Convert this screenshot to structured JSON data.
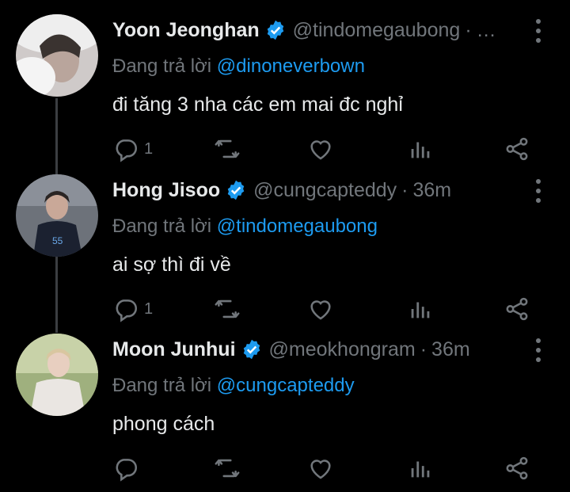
{
  "tweets": [
    {
      "name": "Yoon Jeonghan",
      "handle": "@tindomegaubong",
      "separator": "·",
      "time": "",
      "replying_prefix": "Đang trả lời ",
      "replying_to": "@dinoneverbown",
      "text": "đi tăng 3 nha các em mai đc nghỉ",
      "reply_count": "1",
      "retweet_count": "",
      "like_count": "",
      "avatar_color": "#d8d4d2"
    },
    {
      "name": "Hong Jisoo",
      "handle": "@cungcapteddy",
      "separator": "·",
      "time": "36m",
      "replying_prefix": "Đang trả lời ",
      "replying_to": "@tindomegaubong",
      "text": "ai sợ thì đi về",
      "reply_count": "1",
      "retweet_count": "",
      "like_count": "",
      "avatar_color": "#5a5f66"
    },
    {
      "name": "Moon Junhui",
      "handle": "@meokhongram",
      "separator": "·",
      "time": "36m",
      "replying_prefix": "Đang trả lời ",
      "replying_to": "@cungcapteddy",
      "text": "phong cách",
      "reply_count": "",
      "retweet_count": "",
      "like_count": "",
      "avatar_color": "#a9b98a"
    }
  ],
  "colors": {
    "background": "#000000",
    "accent": "#1d9bf0",
    "muted": "#71767b",
    "text": "#e7e9ea",
    "thread_line": "#3b3e42"
  },
  "icons": [
    "reply-icon",
    "retweet-icon",
    "like-icon",
    "stats-icon",
    "share-icon",
    "verified-badge-icon",
    "more-icon"
  ]
}
